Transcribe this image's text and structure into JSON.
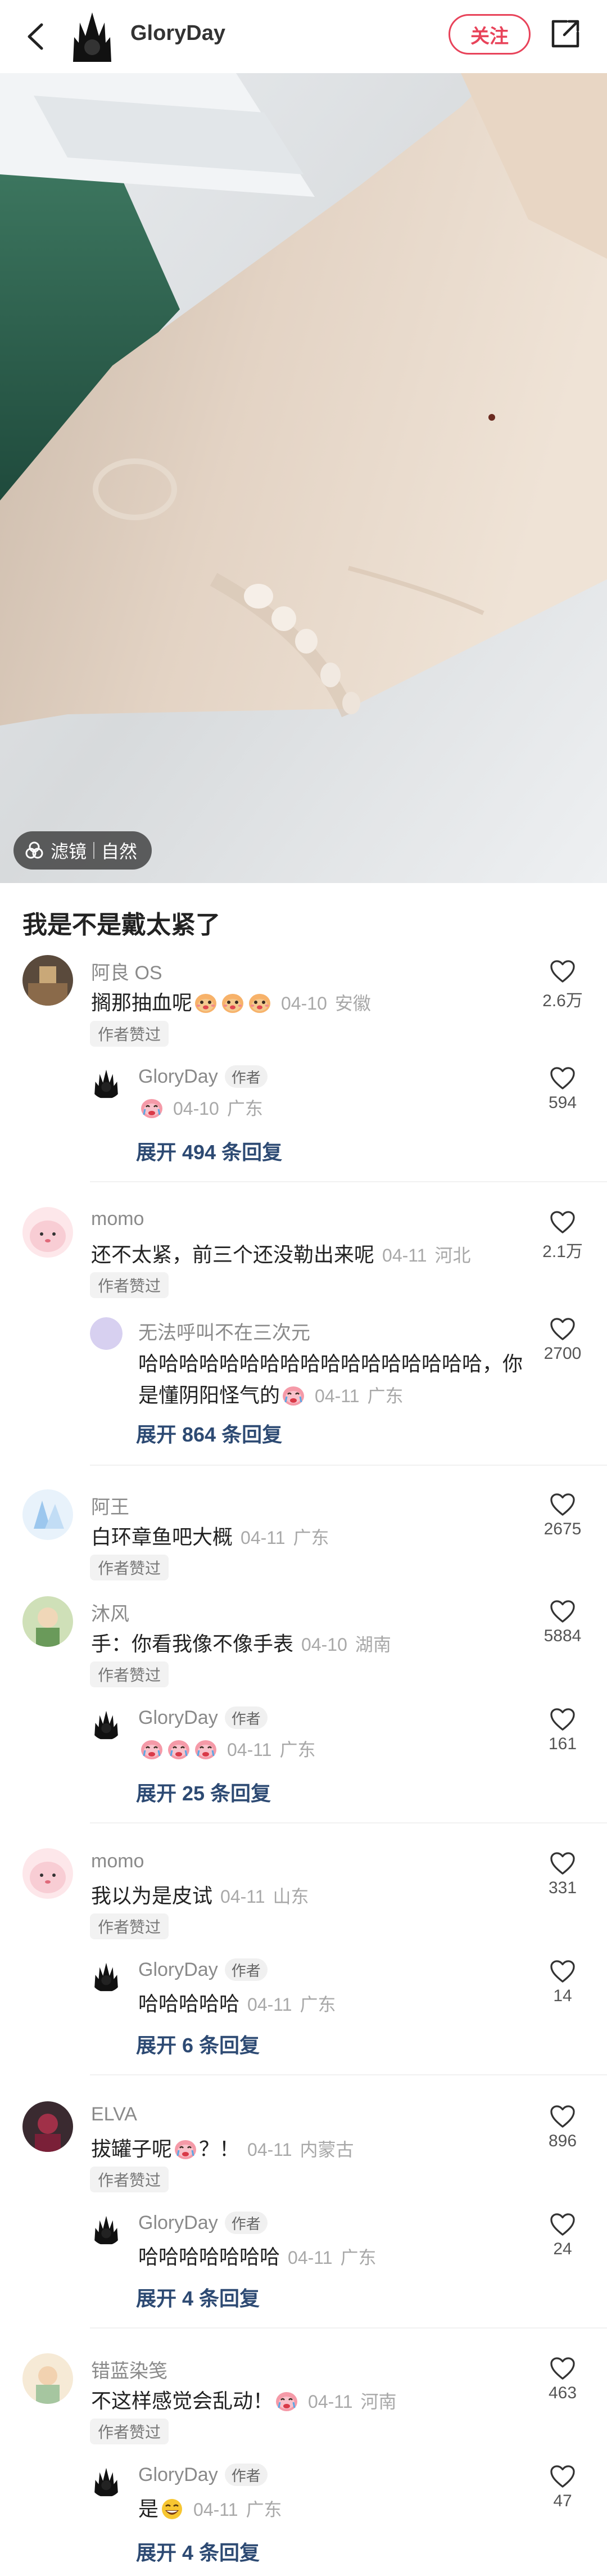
{
  "header": {
    "author_name": "GloryDay",
    "follow_label": "关注"
  },
  "photo": {
    "filter_label": "滤镜",
    "filter_value": "自然"
  },
  "post": {
    "title": "我是不是戴太紧了"
  },
  "comments": [
    {
      "name": "阿良 OS",
      "text": "搁那抽血呢",
      "date": "04-10",
      "location": "安徽",
      "badge": "作者赞过",
      "likes": "2.6万",
      "reply": {
        "name": "GloryDay",
        "tag": "作者",
        "text": "",
        "date": "04-10",
        "location": "广东",
        "likes": "594"
      },
      "expand": "展开 494 条回复"
    },
    {
      "name": "momo",
      "text": "还不太紧，前三个还没勒出来呢",
      "date": "04-11",
      "location": "河北",
      "badge": "作者赞过",
      "likes": "2.1万",
      "reply": {
        "name": "无法呼叫不在三次元",
        "text_line1": "哈哈哈哈哈哈哈哈哈哈哈哈哈哈哈哈哈，你",
        "text_line2": "是懂阴阳怪气的",
        "date": "04-11",
        "location": "广东",
        "likes": "2700"
      },
      "expand": "展开 864 条回复"
    },
    {
      "name": "阿王",
      "text": "白环章鱼吧大概",
      "date": "04-11",
      "location": "广东",
      "badge": "作者赞过",
      "likes": "2675"
    },
    {
      "name": "沐风",
      "text": "手：你看我像不像手表",
      "date": "04-10",
      "location": "湖南",
      "badge": "作者赞过",
      "likes": "5884",
      "reply": {
        "name": "GloryDay",
        "tag": "作者",
        "text": "",
        "date": "04-11",
        "location": "广东",
        "likes": "161"
      },
      "expand": "展开 25 条回复"
    },
    {
      "name": "momo",
      "text": "我以为是皮试",
      "date": "04-11",
      "location": "山东",
      "badge": "作者赞过",
      "likes": "331",
      "reply": {
        "name": "GloryDay",
        "tag": "作者",
        "text": "哈哈哈哈哈",
        "date": "04-11",
        "location": "广东",
        "likes": "14"
      },
      "expand": "展开 6 条回复"
    },
    {
      "name": "ELVA",
      "text_pre": "拔罐子呢",
      "text_post": "？！",
      "date": "04-11",
      "location": "内蒙古",
      "badge": "作者赞过",
      "likes": "896",
      "reply": {
        "name": "GloryDay",
        "tag": "作者",
        "text": "哈哈哈哈哈哈哈",
        "date": "04-11",
        "location": "广东",
        "likes": "24"
      },
      "expand": "展开 4 条回复"
    },
    {
      "name": "错蓝染笺",
      "text": "不这样感觉会乱动！",
      "date": "04-11",
      "location": "河南",
      "badge": "作者赞过",
      "likes": "463",
      "reply": {
        "name": "GloryDay",
        "tag": "作者",
        "text": "是",
        "date": "04-11",
        "location": "广东",
        "likes": "47"
      },
      "expand": "展开 4 条回复"
    }
  ],
  "icons": {
    "back": "chevron-left-icon",
    "share": "share-icon",
    "like": "heart-outline-icon",
    "filter": "filter-icon"
  },
  "colors": {
    "accent": "#e8435a",
    "link": "#2d4a73"
  }
}
